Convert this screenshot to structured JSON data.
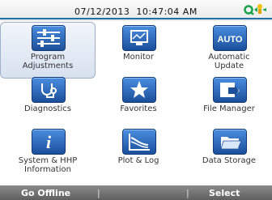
{
  "status_bar": {
    "datetime": "07/12/2013  10:47:04 AM",
    "status_icon": "connection-status-icon"
  },
  "menu": {
    "items": [
      {
        "label": "Program\nAdjustments",
        "icon": "sliders-icon",
        "selected": true
      },
      {
        "label": "Monitor",
        "icon": "monitor-icon",
        "selected": false
      },
      {
        "label": "Automatic\nUpdate",
        "icon": "auto-icon",
        "selected": false
      },
      {
        "label": "Diagnostics",
        "icon": "stethoscope-icon",
        "selected": false
      },
      {
        "label": "Favorites",
        "icon": "star-icon",
        "selected": false
      },
      {
        "label": "File Manager",
        "icon": "file-arrow-icon",
        "selected": false
      },
      {
        "label": "System & HHP\nInformation",
        "icon": "info-icon",
        "selected": false
      },
      {
        "label": "Plot & Log",
        "icon": "chart-icon",
        "selected": false
      },
      {
        "label": "Data Storage",
        "icon": "folder-icon",
        "selected": false
      }
    ],
    "auto_text": "AUTO",
    "info_text": "i"
  },
  "footer": {
    "left_label": "Go Offline",
    "right_label": "Select",
    "separator": "|"
  },
  "colors": {
    "accent": "#1f6fa8",
    "icon_top": "#4a8ee0",
    "icon_bottom": "#1b4f9a",
    "footer": "#6f6f6f"
  }
}
